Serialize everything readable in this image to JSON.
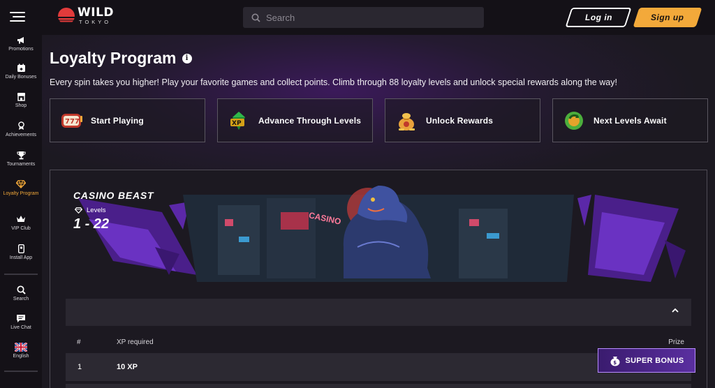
{
  "header": {
    "logo_word": "WILD",
    "logo_sub": "TOKYO",
    "search_placeholder": "Search",
    "login_label": "Log in",
    "signup_label": "Sign up"
  },
  "sidebar": {
    "items": [
      {
        "label": "Promotions",
        "icon": "megaphone-icon"
      },
      {
        "label": "Daily Bonuses",
        "icon": "calendar-gift-icon"
      },
      {
        "label": "Shop",
        "icon": "shop-icon"
      },
      {
        "label": "Achievements",
        "icon": "medal-icon"
      },
      {
        "label": "Tournaments",
        "icon": "trophy-icon"
      },
      {
        "label": "Loyalty Program",
        "icon": "diamond-icon",
        "active": true
      },
      {
        "label": "VIP Club",
        "icon": "crown-icon"
      },
      {
        "label": "Install App",
        "icon": "phone-icon"
      },
      {
        "label": "Search",
        "icon": "search-icon"
      },
      {
        "label": "Live Chat",
        "icon": "chat-icon"
      },
      {
        "label": "English",
        "icon": "uk-flag-icon"
      }
    ]
  },
  "main": {
    "title": "Loyalty Program",
    "subtitle": "Every spin takes you higher! Play your favorite games and collect points. Climb through 88 loyalty levels and unlock special rewards along the way!",
    "steps": [
      {
        "label": "Start Playing",
        "icon": "slot-reels-icon"
      },
      {
        "label": "Advance Through Levels",
        "icon": "xp-gem-icon"
      },
      {
        "label": "Unlock Rewards",
        "icon": "money-bag-icon"
      },
      {
        "label": "Next Levels Await",
        "icon": "refresh-arrow-icon"
      }
    ],
    "tier": {
      "name": "CASINO BEAST",
      "levels_label": "Levels",
      "levels_range": "1 - 22",
      "sign_text": "CASINO"
    },
    "table": {
      "col_num": "#",
      "col_xp": "XP required",
      "col_prize": "Prize",
      "rows": [
        {
          "num": "1",
          "xp": "10 XP"
        }
      ]
    }
  },
  "super_bonus": {
    "label": "SUPER BONUS"
  },
  "colors": {
    "accent_orange": "#f3a93a",
    "accent_purple": "#5a2fa0",
    "background": "#1c1921"
  }
}
